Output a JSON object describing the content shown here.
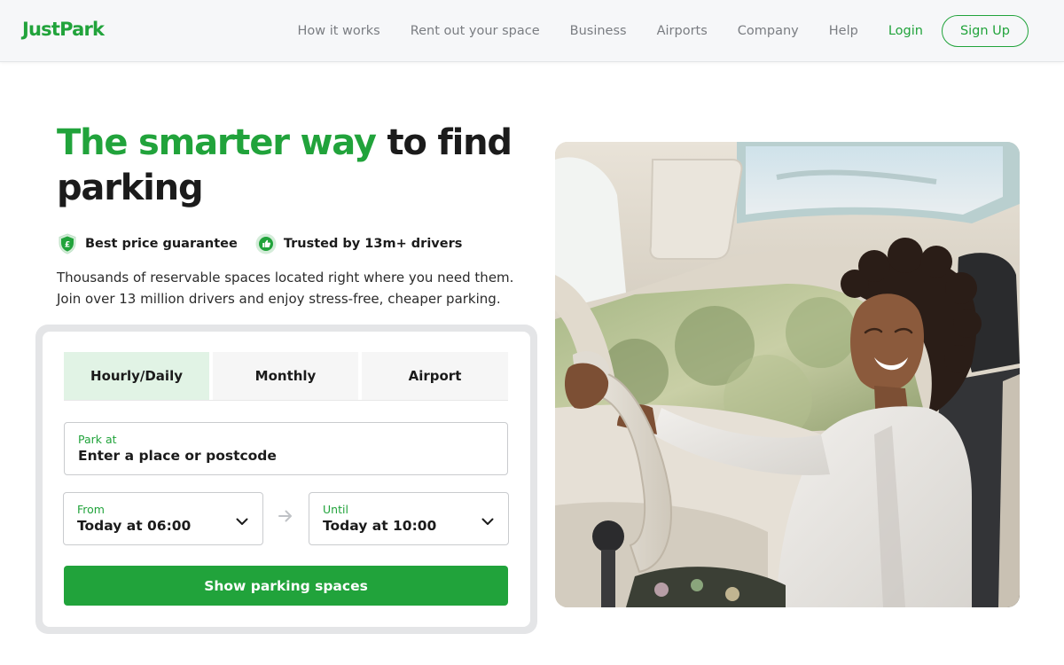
{
  "brand": {
    "logo_text": "JustPark",
    "accent_color": "#21a33b"
  },
  "nav": {
    "links": [
      "How it works",
      "Rent out your space",
      "Business",
      "Airports",
      "Company",
      "Help"
    ],
    "login_label": "Login",
    "signup_label": "Sign Up"
  },
  "hero": {
    "headline_green": "The smarter way",
    "headline_rest": " to find parking",
    "badges": [
      {
        "icon": "shield-pound-icon",
        "label": "Best price guarantee"
      },
      {
        "icon": "thumbs-up-icon",
        "label": "Trusted by 13m+ drivers"
      }
    ],
    "description_line1": "Thousands of reservable spaces located right where you need them.",
    "description_line2": "Join over 13 million drivers and enjoy stress-free, cheaper parking."
  },
  "search": {
    "tabs": [
      {
        "label": "Hourly/Daily",
        "active": true
      },
      {
        "label": "Monthly",
        "active": false
      },
      {
        "label": "Airport",
        "active": false
      }
    ],
    "park_at": {
      "label": "Park at",
      "placeholder": "Enter a place or postcode"
    },
    "from": {
      "label": "From",
      "value": "Today at 06:00"
    },
    "until": {
      "label": "Until",
      "value": "Today at 10:00"
    },
    "submit_label": "Show parking spaces"
  },
  "image": {
    "subject": "woman-driving-car-photo"
  }
}
